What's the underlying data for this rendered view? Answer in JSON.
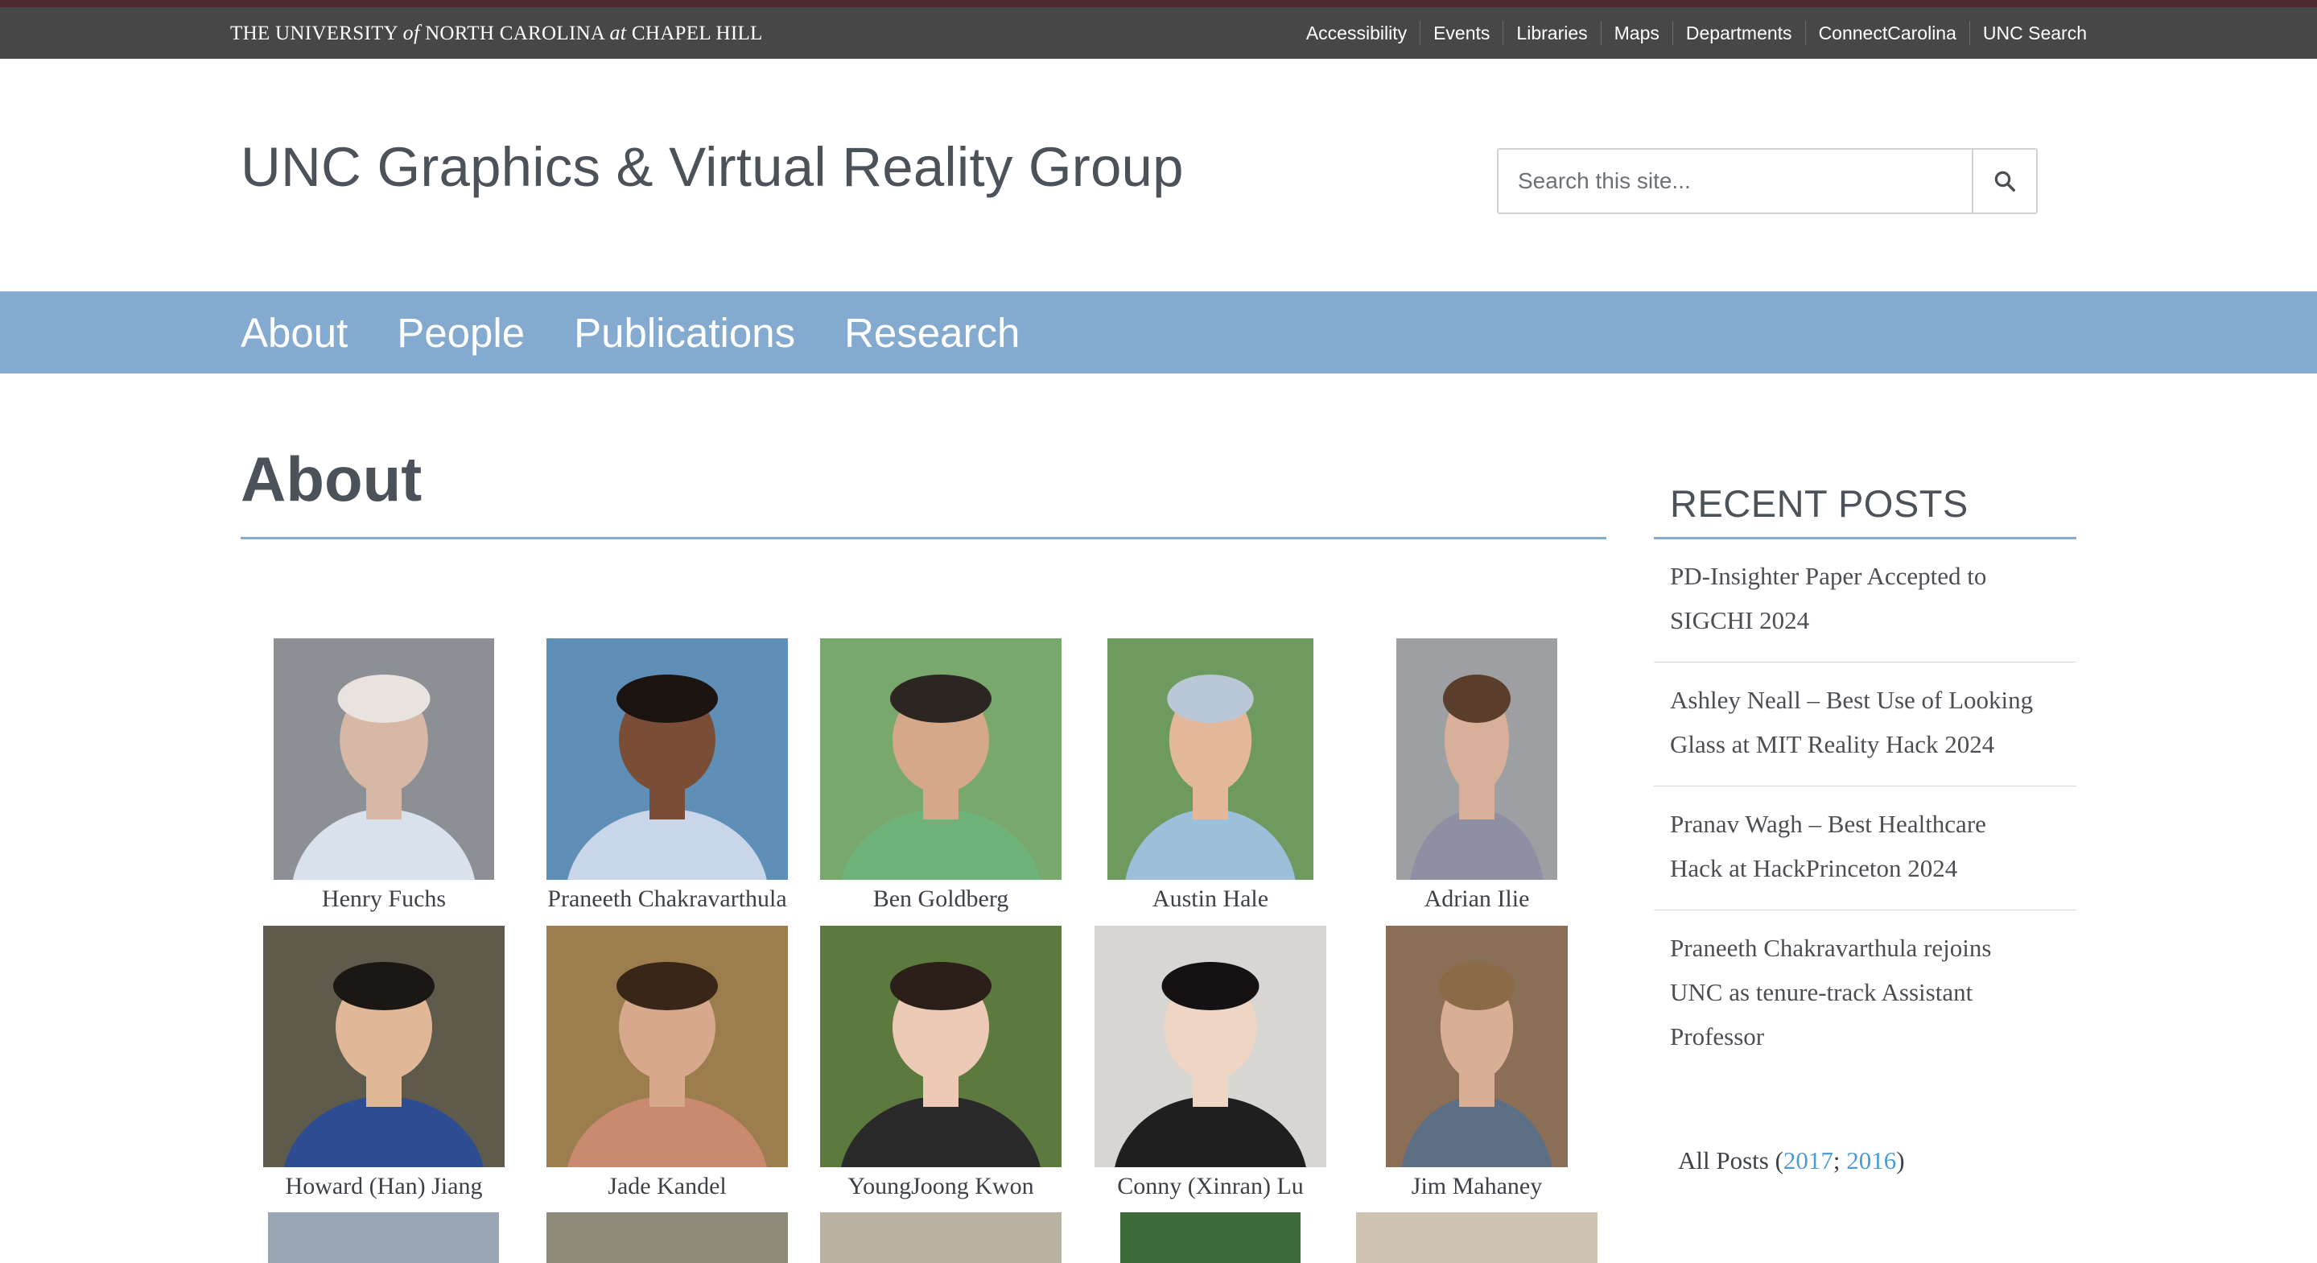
{
  "utility_bar": {
    "logo": {
      "pre": "THE UNIVERSITY",
      "of": "of",
      "mid": "NORTH CAROLINA",
      "at": "at",
      "post": "CHAPEL HILL"
    },
    "links": [
      "Accessibility",
      "Events",
      "Libraries",
      "Maps",
      "Departments",
      "ConnectCarolina",
      "UNC Search"
    ]
  },
  "header": {
    "site_title": "UNC Graphics & Virtual Reality Group",
    "search_placeholder": "Search this site...",
    "search_icon": "search-icon"
  },
  "nav": {
    "items": [
      "About",
      "People",
      "Publications",
      "Research"
    ]
  },
  "main": {
    "heading": "About",
    "people": [
      {
        "name": "Henry Fuchs"
      },
      {
        "name": "Praneeth Chakravarthula"
      },
      {
        "name": "Ben Goldberg"
      },
      {
        "name": "Austin Hale"
      },
      {
        "name": "Adrian Ilie"
      },
      {
        "name": "Howard (Han) Jiang"
      },
      {
        "name": "Jade Kandel"
      },
      {
        "name": "YoungJoong Kwon"
      },
      {
        "name": "Conny (Xinran) Lu"
      },
      {
        "name": "Jim Mahaney"
      }
    ]
  },
  "sidebar": {
    "title": "RECENT POSTS",
    "posts": [
      {
        "lines": [
          "PD-Insighter Paper Accepted to",
          "SIGCHI 2024"
        ]
      },
      {
        "lines": [
          "Ashley Neall – Best Use of Looking",
          "Glass at MIT Reality Hack 2024"
        ]
      },
      {
        "lines": [
          "Pranav Wagh – Best Healthcare",
          "Hack at HackPrinceton 2024"
        ]
      },
      {
        "lines": [
          "Praneeth Chakravarthula rejoins",
          "UNC as tenure-track Assistant",
          "Professor"
        ]
      }
    ],
    "all_posts": {
      "label": "All Posts (",
      "year1": "2017",
      "sep": "; ",
      "year2": "2016",
      "close": ")"
    }
  }
}
